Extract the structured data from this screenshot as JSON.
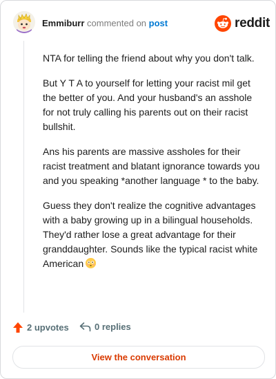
{
  "header": {
    "username": "Emmiburr",
    "verb": "commented on",
    "link_text": "post",
    "brand": "reddit"
  },
  "comment": {
    "paragraphs": [
      "NTA for telling the friend about why you don't talk.",
      "But Y T A to yourself for letting your racist mil get the better of you. And your husband's an asshole for not truly calling his parents out on their racist bullshit.",
      "Ans his parents are massive assholes for their racist treatment and blatant ignorance towards you and you speaking *another language * to the baby.",
      "Guess they don't realize the cognitive advantages with a baby growing up in a bilingual households. They'd rather lose a great advantage for their granddaughter. Sounds like the typical racist white American"
    ]
  },
  "footer": {
    "upvotes": "2 upvotes",
    "replies": "0 replies",
    "view_button": "View the conversation"
  },
  "colors": {
    "reddit_orange": "#ff4500",
    "link_blue": "#0079d3",
    "button_text": "#d93a00"
  },
  "icons": {
    "logo": "reddit-alien-icon",
    "upvote": "upvote-arrow-icon",
    "reply": "reply-arrow-icon",
    "emoji": "flushed-face-emoji-icon"
  }
}
